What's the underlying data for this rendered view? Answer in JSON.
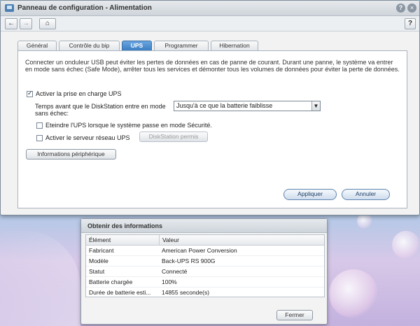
{
  "window": {
    "title": "Panneau de configuration - Alimentation",
    "help_icon": "?",
    "close_icon": "×"
  },
  "nav": {
    "back_icon": "←",
    "forward_icon": "→",
    "home_icon": "⌂",
    "question_icon": "?"
  },
  "tabs": [
    {
      "label": "Général"
    },
    {
      "label": "Contrôle du bip"
    },
    {
      "label": "UPS"
    },
    {
      "label": "Programmer"
    },
    {
      "label": "Hibernation"
    }
  ],
  "ups": {
    "description": "Connecter un onduleur USB peut éviter les pertes de données en cas de panne de courant. Durant une panne, le système va entrer en mode sans échec (Safe Mode), arrêter tous les services et démonter tous les volumes de données pour éviter la perte de données.",
    "enable_label": "Activer la prise en charge UPS",
    "enable_checked": true,
    "time_label": "Temps avant que le DiskStation entre en mode sans échec:",
    "time_value": "Jusqu'à ce que la batterie faiblisse",
    "shutdown_label": "Eteindre l'UPS lorsque le système passe en mode Sécurité.",
    "shutdown_checked": false,
    "network_label": "Activer le serveur réseau UPS",
    "network_checked": false,
    "permit_button": "DiskStation permis",
    "device_info_button": "Informations périphérique",
    "apply_button": "Appliquer",
    "cancel_button": "Annuler"
  },
  "dialog": {
    "title": "Obtenir des informations",
    "columns": [
      "Élément",
      "Valeur"
    ],
    "rows": [
      {
        "item": "Fabricant",
        "value": "American Power Conversion"
      },
      {
        "item": "Modèle",
        "value": "Back-UPS RS 900G"
      },
      {
        "item": "Statut",
        "value": "Connecté"
      },
      {
        "item": "Batterie chargée",
        "value": "100%"
      },
      {
        "item": "Durée de batterie esti...",
        "value": "14855 seconde(s)"
      }
    ],
    "close_button": "Fermer"
  }
}
